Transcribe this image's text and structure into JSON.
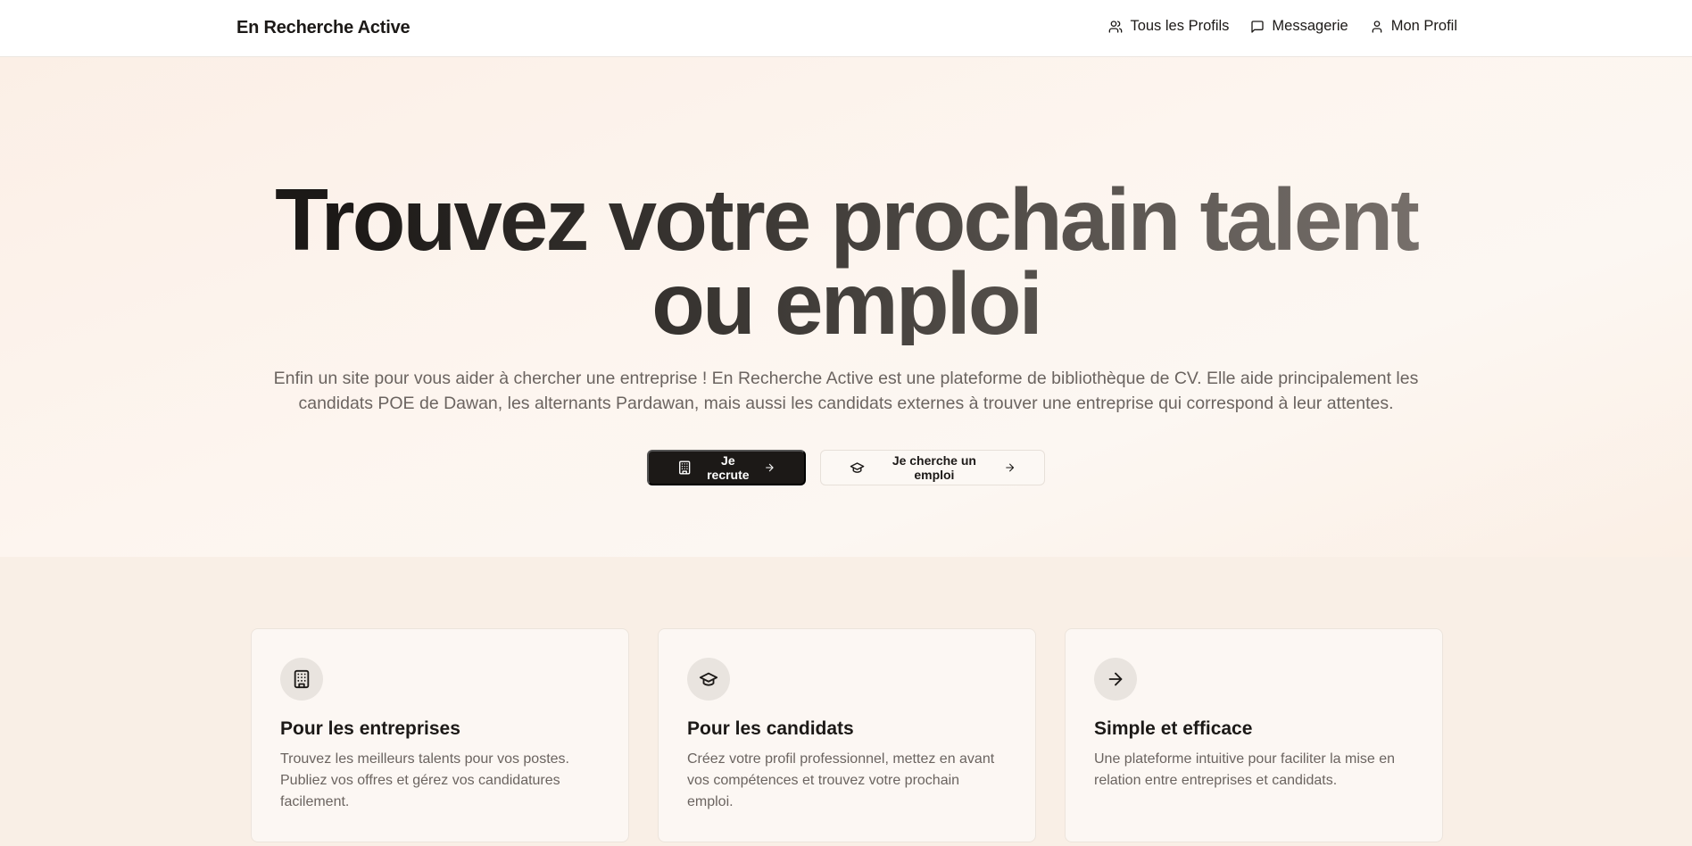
{
  "nav": {
    "brand": "En Recherche Active",
    "links": [
      {
        "label": "Tous les Profils",
        "icon": "users-icon"
      },
      {
        "label": "Messagerie",
        "icon": "message-icon"
      },
      {
        "label": "Mon Profil",
        "icon": "user-icon"
      }
    ]
  },
  "hero": {
    "title_line1": "Trouvez votre prochain talent",
    "title_line2": "ou emploi",
    "subtitle": "Enfin un site pour vous aider à chercher une entreprise ! En Recherche Active est une plateforme de bibliothèque de CV. Elle aide principalement les candidats POE de Dawan, les alternants Pardawan, mais aussi les candidats externes à trouver une entreprise qui correspond à leur attentes.",
    "primary_button": "Je recrute",
    "secondary_button": "Je cherche un emploi"
  },
  "features": [
    {
      "icon": "building-icon",
      "title": "Pour les entreprises",
      "text": "Trouvez les meilleurs talents pour vos postes. Publiez vos offres et gérez vos candidatures facilement."
    },
    {
      "icon": "graduation-cap-icon",
      "title": "Pour les candidats",
      "text": "Créez votre profil professionnel, mettez en avant vos compétences et trouvez votre prochain emploi."
    },
    {
      "icon": "arrow-right-icon",
      "title": "Simple et efficace",
      "text": "Une plateforme intuitive pour faciliter la mise en relation entre entreprises et candidats."
    }
  ],
  "colors": {
    "primary": "#1c1917",
    "background": "#f9efe6",
    "muted_text": "#6b6460"
  }
}
